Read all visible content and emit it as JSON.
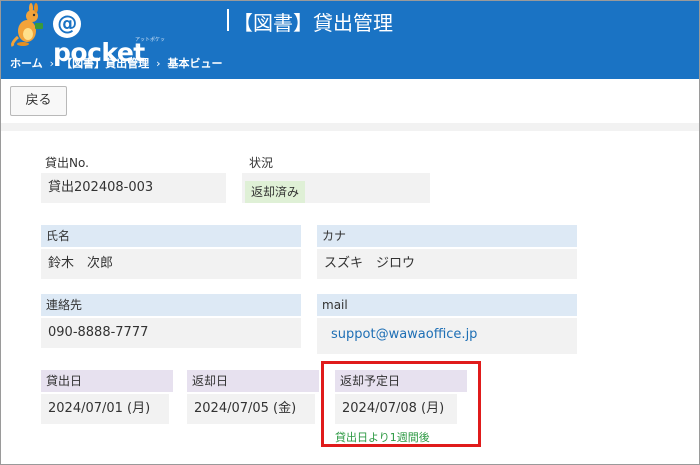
{
  "header": {
    "logo_text": "pocket",
    "logo_at": "@",
    "logo_sub": "アットポケット",
    "app_title": "【図書】貸出管理"
  },
  "breadcrumb": [
    "ホーム",
    "【図書】貸出管理",
    "基本ビュー"
  ],
  "breadcrumb_separator": "›",
  "toolbar": {
    "back_label": "戻る"
  },
  "fields": {
    "loan_no": {
      "label": "貸出No.",
      "value": "貸出202408-003"
    },
    "status": {
      "label": "状況",
      "value": "返却済み"
    },
    "name": {
      "label": "氏名",
      "value": "鈴木　次郎"
    },
    "kana": {
      "label": "カナ",
      "value": "スズキ　ジロウ"
    },
    "contact": {
      "label": "連絡先",
      "value": "090-8888-7777"
    },
    "mail": {
      "label": "mail",
      "value": "suppot@wawaoffice.jp"
    },
    "loan_date": {
      "label": "貸出日",
      "value": "2024/07/01 (月)"
    },
    "return_date": {
      "label": "返却日",
      "value": "2024/07/05 (金)"
    },
    "due_date": {
      "label": "返却予定日",
      "value": "2024/07/08 (月)",
      "note": "貸出日より1週間後"
    }
  },
  "colors": {
    "header_bg": "#1a73c4",
    "label_blue": "#dde9f5",
    "label_purple": "#e7e1ef",
    "status_chip": "#dff0d6",
    "highlight_border": "#e01b1b",
    "note_text": "#2e9a44",
    "link": "#1e6fb5"
  },
  "icons": {
    "logo": "kangaroo-mascot-icon"
  }
}
